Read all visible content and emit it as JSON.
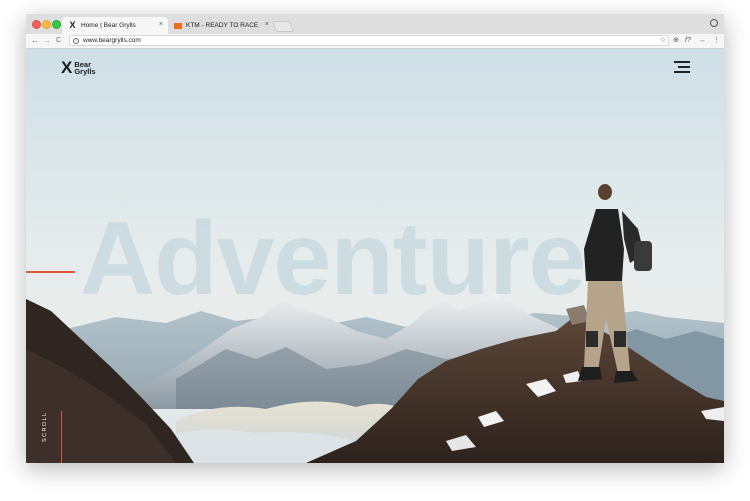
{
  "browser": {
    "tabs": [
      {
        "title": "Home | Bear Grylls",
        "favicon": "bear-grylls-x-logo",
        "active": true
      },
      {
        "title": "KTM - READY TO RACE",
        "favicon": "ktm-logo",
        "active": false
      }
    ],
    "tab_close_glyph": "×",
    "address": "www.beargrylls.com",
    "nav": {
      "back": "←",
      "forward": "→",
      "reload": "C"
    },
    "extensions": [
      "⊕",
      "f?",
      "↔",
      "⋮"
    ],
    "star": "☆"
  },
  "site": {
    "logo_mark": "X",
    "logo_line1": "Bear",
    "logo_line2": "Grylls",
    "hero_word": "Adventure",
    "scroll_label": "SCROLL",
    "accent_color": "#e2553a"
  }
}
